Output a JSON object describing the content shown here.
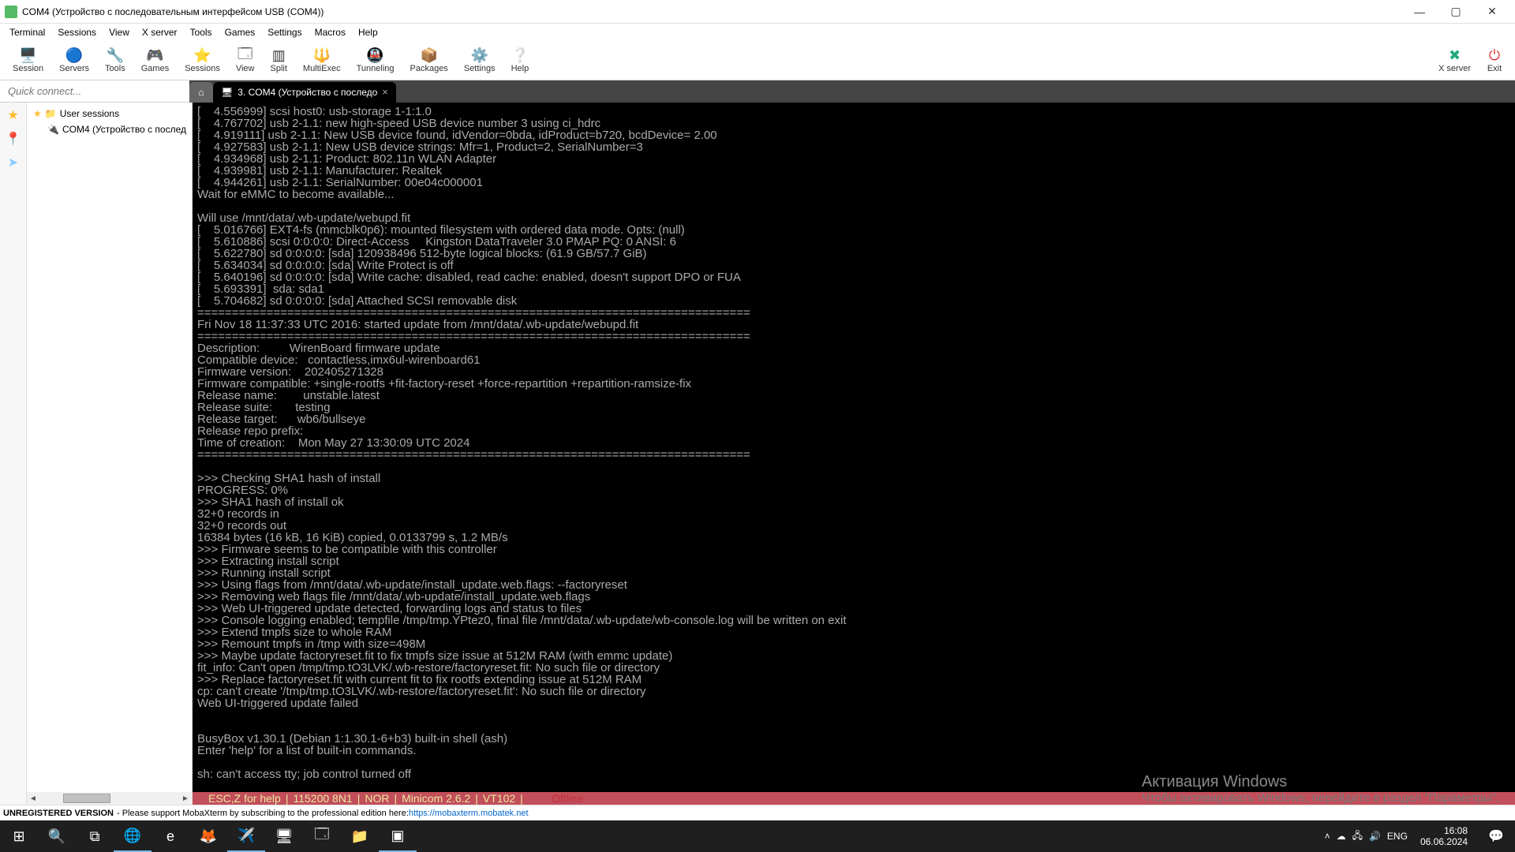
{
  "win": {
    "title": "COM4 (Устройство с последовательным интерфейсом USB (COM4))"
  },
  "menu": [
    "Terminal",
    "Sessions",
    "View",
    "X server",
    "Tools",
    "Games",
    "Settings",
    "Macros",
    "Help"
  ],
  "toolbar": [
    {
      "icon": "🖥️",
      "label": "Session",
      "name": "session-button"
    },
    {
      "icon": "🔵",
      "label": "Servers",
      "name": "servers-button"
    },
    {
      "icon": "🔧",
      "label": "Tools",
      "name": "tools-button"
    },
    {
      "icon": "🎮",
      "label": "Games",
      "name": "games-button"
    },
    {
      "icon": "⭐",
      "label": "Sessions",
      "name": "sessions-button"
    },
    {
      "icon": "🗔",
      "label": "View",
      "name": "view-button"
    },
    {
      "icon": "▥",
      "label": "Split",
      "name": "split-button"
    },
    {
      "icon": "🔱",
      "label": "MultiExec",
      "name": "multiexec-button"
    },
    {
      "icon": "🚇",
      "label": "Tunneling",
      "name": "tunneling-button"
    },
    {
      "icon": "📦",
      "label": "Packages",
      "name": "packages-button"
    },
    {
      "icon": "⚙️",
      "label": "Settings",
      "name": "settings-button"
    },
    {
      "icon": "❔",
      "label": "Help",
      "name": "help-button"
    }
  ],
  "toolbar_right": [
    {
      "icon": "✖",
      "label": "X server",
      "name": "xserver-button",
      "color": "#2a7"
    },
    {
      "icon": "⏻",
      "label": "Exit",
      "name": "exit-button",
      "color": "#d33"
    }
  ],
  "quickconnect_placeholder": "Quick connect...",
  "tabs": {
    "home_icon": "⌂",
    "active": {
      "icon": "🖥",
      "label": "3. COM4 (Устройство с последо"
    }
  },
  "sidebar": {
    "root": "User sessions",
    "item": "COM4 (Устройство с послед"
  },
  "terminal_lines": [
    "[    4.556999] scsi host0: usb-storage 1-1:1.0",
    "[    4.767702] usb 2-1.1: new high-speed USB device number 3 using ci_hdrc",
    "[    4.919111] usb 2-1.1: New USB device found, idVendor=0bda, idProduct=b720, bcdDevice= 2.00",
    "[    4.927583] usb 2-1.1: New USB device strings: Mfr=1, Product=2, SerialNumber=3",
    "[    4.934968] usb 2-1.1: Product: 802.11n WLAN Adapter",
    "[    4.939981] usb 2-1.1: Manufacturer: Realtek",
    "[    4.944261] usb 2-1.1: SerialNumber: 00e04c000001",
    "Wait for eMMC to become available...",
    "",
    "Will use /mnt/data/.wb-update/webupd.fit",
    "[    5.016766] EXT4-fs (mmcblk0p6): mounted filesystem with ordered data mode. Opts: (null)",
    "[    5.610886] scsi 0:0:0:0: Direct-Access     Kingston DataTraveler 3.0 PMAP PQ: 0 ANSI: 6",
    "[    5.622780] sd 0:0:0:0: [sda] 120938496 512-byte logical blocks: (61.9 GB/57.7 GiB)",
    "[    5.634034] sd 0:0:0:0: [sda] Write Protect is off",
    "[    5.640196] sd 0:0:0:0: [sda] Write cache: disabled, read cache: enabled, doesn't support DPO or FUA",
    "[    5.693391]  sda: sda1",
    "[    5.704682] sd 0:0:0:0: [sda] Attached SCSI removable disk",
    "================================================================================",
    "Fri Nov 18 11:37:33 UTC 2016: started update from /mnt/data/.wb-update/webupd.fit",
    "================================================================================",
    "Description:         WirenBoard firmware update",
    "Compatible device:   contactless,imx6ul-wirenboard61",
    "Firmware version:    202405271328",
    "Firmware compatible: +single-rootfs +fit-factory-reset +force-repartition +repartition-ramsize-fix",
    "Release name:        unstable.latest",
    "Release suite:       testing",
    "Release target:      wb6/bullseye",
    "Release repo prefix:",
    "Time of creation:    Mon May 27 13:30:09 UTC 2024",
    "================================================================================",
    "",
    ">>> Checking SHA1 hash of install",
    "PROGRESS: 0%",
    ">>> SHA1 hash of install ok",
    "32+0 records in",
    "32+0 records out",
    "16384 bytes (16 kB, 16 KiB) copied, 0.0133799 s, 1.2 MB/s",
    ">>> Firmware seems to be compatible with this controller",
    ">>> Extracting install script",
    ">>> Running install script",
    ">>> Using flags from /mnt/data/.wb-update/install_update.web.flags: --factoryreset",
    ">>> Removing web flags file /mnt/data/.wb-update/install_update.web.flags",
    ">>> Web UI-triggered update detected, forwarding logs and status to files",
    ">>> Console logging enabled; tempfile /tmp/tmp.YPtez0, final file /mnt/data/.wb-update/wb-console.log will be written on exit",
    ">>> Extend tmpfs size to whole RAM",
    ">>> Remount tmpfs in /tmp with size=498M",
    ">>> Maybe update factoryreset.fit to fix tmpfs size issue at 512M RAM (with emmc update)",
    "fit_info: Can't open /tmp/tmp.tO3LVK/.wb-restore/factoryreset.fit: No such file or directory",
    ">>> Replace factoryreset.fit with current fit to fix rootfs extending issue at 512M RAM",
    "cp: can't create '/tmp/tmp.tO3LVK/.wb-restore/factoryreset.fit': No such file or directory",
    "Web UI-triggered update failed",
    "",
    "",
    "BusyBox v1.30.1 (Debian 1:1.30.1-6+b3) built-in shell (ash)",
    "Enter 'help' for a list of built-in commands.",
    "",
    "sh: can't access tty; job control turned off",
    "~ # "
  ],
  "status": {
    "help": "ESC,Z for help",
    "baud": "115200 8N1",
    "nor": "NOR",
    "app": "Minicom 2.6.2",
    "term": "VT102",
    "state": "Offline"
  },
  "footer": {
    "unreg": "UNREGISTERED VERSION",
    "msg": " - Please support MobaXterm by subscribing to the professional edition here: ",
    "url": "https://mobaxterm.mobatek.net"
  },
  "watermark": {
    "h": "Активация Windows",
    "s": "Чтобы активировать Windows, перейдите в раздел \"Параметры\"."
  },
  "tray": {
    "lang": "ENG",
    "time": "16:08",
    "date": "06.06.2024"
  }
}
